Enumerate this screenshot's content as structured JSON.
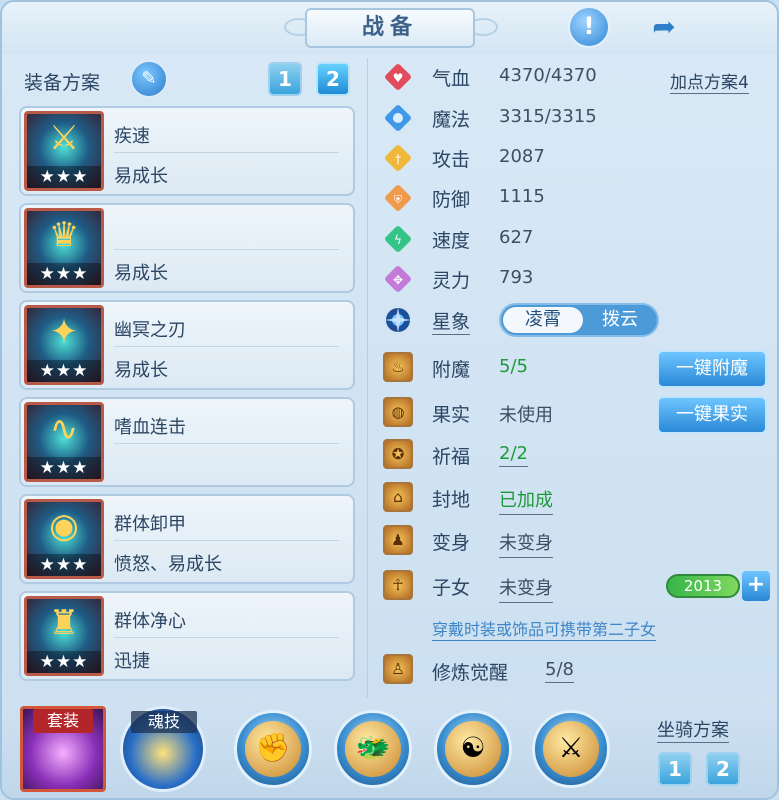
{
  "header": {
    "title": "战备",
    "alert_icon": "!",
    "share_icon": "share-arrow"
  },
  "equip": {
    "title": "装备方案",
    "plan_buttons": [
      "1",
      "2"
    ],
    "active_plan": "2",
    "items": [
      {
        "name": "疾速",
        "tags": "易成长",
        "stars": "★★★",
        "icon": "⚔",
        "frame": "#b85a47"
      },
      {
        "name": "",
        "tags": "易成长",
        "stars": "★★★",
        "icon": "♛",
        "frame": "#b85a47"
      },
      {
        "name": "幽冥之刃",
        "tags": "易成长",
        "stars": "★★★",
        "icon": "✦",
        "frame": "#b85a47"
      },
      {
        "name": "嗜血连击",
        "tags": "",
        "stars": "★★★",
        "icon": "∿",
        "frame": "#b85a47"
      },
      {
        "name": "群体卸甲",
        "tags": "愤怒、易成长",
        "stars": "★★★",
        "icon": "◉",
        "frame": "#b85a47"
      },
      {
        "name": "群体净心",
        "tags": "迅捷",
        "stars": "★★★",
        "icon": "♜",
        "frame": "#b85a47"
      }
    ]
  },
  "stats": {
    "hp": {
      "label": "气血",
      "value": "4370/4370",
      "color": "#e24b5b"
    },
    "mp": {
      "label": "魔法",
      "value": "3315/3315",
      "color": "#3f98e8"
    },
    "atk": {
      "label": "攻击",
      "value": "2087",
      "color": "#f0b83a"
    },
    "def": {
      "label": "防御",
      "value": "1115",
      "color": "#f09a4e"
    },
    "spd": {
      "label": "速度",
      "value": "627",
      "color": "#35c488"
    },
    "spi": {
      "label": "灵力",
      "value": "793",
      "color": "#c47ad8"
    },
    "point_plan": "加点方案4"
  },
  "star": {
    "label": "星象",
    "options": [
      "凌霄",
      "拨云"
    ],
    "selected": "凌霄"
  },
  "extras": [
    {
      "label": "附魔",
      "value": "5/5",
      "green": true,
      "underline": false,
      "icon": "♨"
    },
    {
      "label": "果实",
      "value": "未使用",
      "green": false,
      "underline": false,
      "icon": "◍"
    },
    {
      "label": "祈福",
      "value": "2/2",
      "green": true,
      "underline": true,
      "icon": "✪"
    },
    {
      "label": "封地",
      "value": "已加成",
      "green": true,
      "underline": true,
      "icon": "⌂"
    },
    {
      "label": "变身",
      "value": "未变身",
      "green": false,
      "underline": true,
      "icon": "♟"
    },
    {
      "label": "子女",
      "value": "未变身",
      "green": false,
      "underline": true,
      "icon": "☥"
    }
  ],
  "buttons": {
    "enchant_all": "一键附魔",
    "fruit_all": "一键果实"
  },
  "child_bar": {
    "value": "2013",
    "plus": "+"
  },
  "tip": "穿戴时装或饰品可携带第二子女",
  "awaken": {
    "label": "修炼觉醒",
    "value": "5/8",
    "icon": "♙"
  },
  "bottom": {
    "suit_label": "套装",
    "soul_label": "魂技",
    "skills": [
      {
        "name": "fist-skill",
        "glyph": "✊"
      },
      {
        "name": "claw-skill",
        "glyph": "🐲"
      },
      {
        "name": "yin-yang-skill",
        "glyph": "☯"
      },
      {
        "name": "sword-skill",
        "glyph": "⚔"
      }
    ],
    "mount_label": "坐骑方案",
    "mount_buttons": [
      "1",
      "2"
    ]
  }
}
